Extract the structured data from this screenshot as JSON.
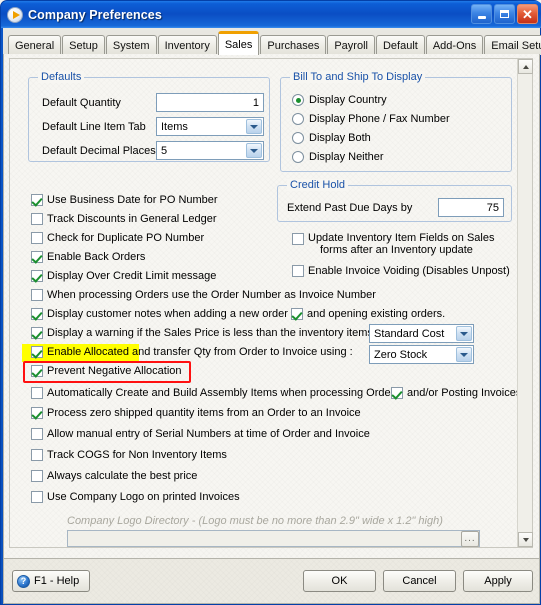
{
  "window": {
    "title": "Company Preferences",
    "icon": "play-circle-icon",
    "controls": {
      "minimize": "minimize-icon",
      "maximize": "maximize-icon",
      "close": "close-icon"
    }
  },
  "tabs": [
    {
      "label": "General",
      "active": false
    },
    {
      "label": "Setup",
      "active": false
    },
    {
      "label": "System",
      "active": false
    },
    {
      "label": "Inventory",
      "active": false
    },
    {
      "label": "Sales",
      "active": true
    },
    {
      "label": "Purchases",
      "active": false
    },
    {
      "label": "Payroll",
      "active": false
    },
    {
      "label": "Default",
      "active": false
    },
    {
      "label": "Add-Ons",
      "active": false
    },
    {
      "label": "Email Setup",
      "active": false
    }
  ],
  "defaults_group": {
    "legend": "Defaults",
    "quantity_label": "Default Quantity",
    "quantity_value": "1",
    "line_item_tab_label": "Default Line Item Tab",
    "line_item_tab_value": "Items",
    "decimal_places_label": "Default Decimal Places",
    "decimal_places_value": "5"
  },
  "bill_ship_group": {
    "legend": "Bill To and Ship To Display",
    "options": [
      {
        "label": "Display Country",
        "selected": true
      },
      {
        "label": "Display Phone / Fax Number",
        "selected": false
      },
      {
        "label": "Display Both",
        "selected": false
      },
      {
        "label": "Display Neither",
        "selected": false
      }
    ]
  },
  "credit_hold_group": {
    "legend": "Credit Hold",
    "extend_label": "Extend Past Due Days by",
    "extend_value": "75"
  },
  "left_checks": [
    {
      "label": "Use Business Date for PO Number",
      "checked": true
    },
    {
      "label": "Track Discounts in General Ledger",
      "checked": false
    },
    {
      "label": "Check for Duplicate PO Number",
      "checked": false
    },
    {
      "label": "Enable Back Orders",
      "checked": true
    },
    {
      "label": "Display Over Credit Limit message",
      "checked": true
    },
    {
      "label": "When processing Orders use the Order Number as Invoice Number",
      "checked": false
    }
  ],
  "right_checks": [
    {
      "label": "Update Inventory Item Fields on Sales",
      "label2": "forms after an Inventory update",
      "checked": false
    },
    {
      "label": "Enable Invoice Voiding (Disables Unpost)",
      "checked": false
    }
  ],
  "notes_row": {
    "label": "Display customer notes when adding a new order",
    "checked": true,
    "sub_label": "and opening existing orders.",
    "sub_checked": true
  },
  "warning_row": {
    "label": "Display a warning if the Sales Price is less than the inventory items",
    "checked": true,
    "combo_value": "Standard Cost"
  },
  "allocated_row": {
    "label_highlight": "Enable Allocated",
    "label_rest": " and transfer Qty from Order to Invoice using :",
    "checked": true,
    "combo_value": "Zero Stock",
    "highlight_color": "#ffff00"
  },
  "prevent_row": {
    "label": "Prevent Negative Allocation",
    "checked": true,
    "outline_color": "#ff1010"
  },
  "assembly_row": {
    "label": "Automatically Create and Build Assembly Items when processing Orders",
    "checked": false,
    "sub_label": "and/or Posting Invoices",
    "sub_checked": true
  },
  "bottom_checks": [
    {
      "label": "Process zero shipped quantity items from an Order to an Invoice",
      "checked": true
    },
    {
      "label": "Allow manual entry of Serial Numbers at time of Order and Invoice",
      "checked": false
    },
    {
      "label": "Track COGS for Non Inventory Items",
      "checked": false
    },
    {
      "label": "Always calculate the best price",
      "checked": false
    },
    {
      "label": "Use Company Logo on printed Invoices",
      "checked": false
    }
  ],
  "logo": {
    "note": "Company Logo Directory - (Logo must be no more than 2.9\" wide x 1.2\" high)",
    "path_value": "",
    "browse_label": "..."
  },
  "footer": {
    "help_label": "F1 - Help",
    "help_icon": "question-mark-icon",
    "ok_label": "OK",
    "cancel_label": "Cancel",
    "apply_label": "Apply"
  }
}
